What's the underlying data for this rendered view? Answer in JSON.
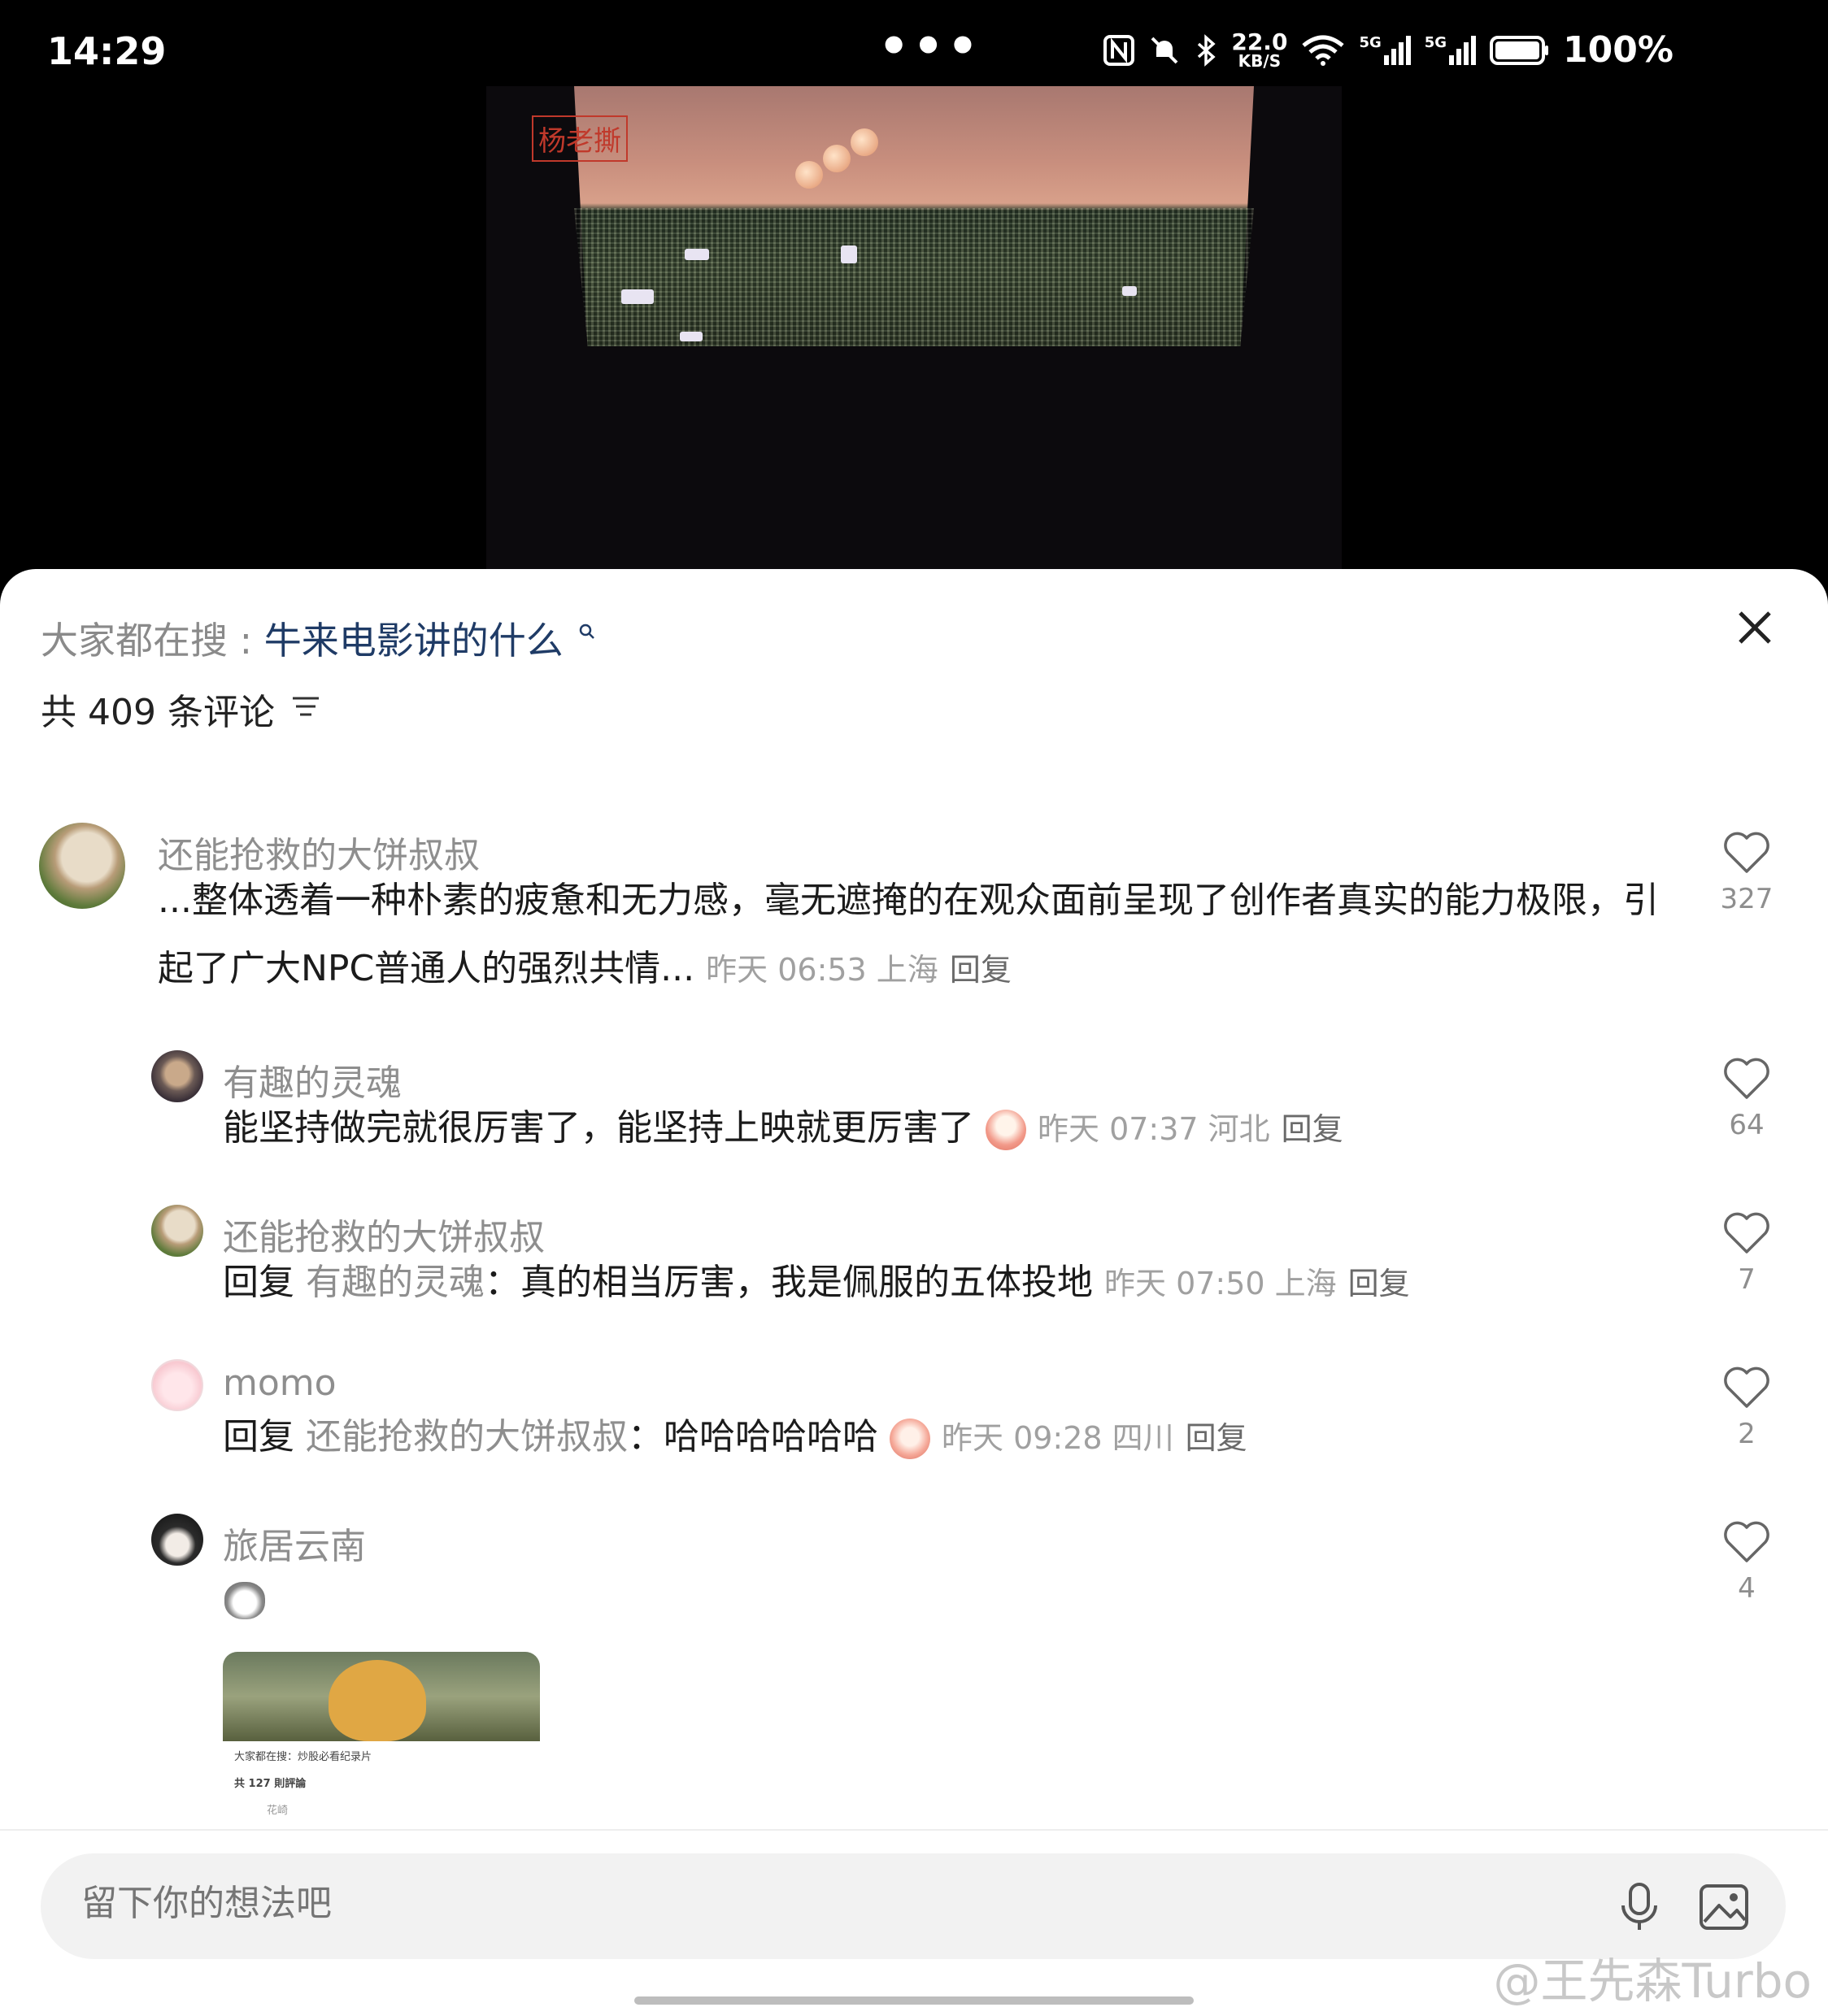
{
  "status": {
    "time": "14:29",
    "dots": "•••",
    "speed_value": "22.0",
    "speed_unit": "KB/S",
    "battery": "100%",
    "net1": "5G",
    "net2": "5G"
  },
  "video": {
    "seal_text": "杨老撕"
  },
  "header": {
    "search_prefix": "大家都在搜",
    "search_separator": ":",
    "search_term": "牛来电影讲的什么",
    "search_icon": "search-icon",
    "comment_count_text": "共 409 条评论",
    "close_icon": "close-icon",
    "sort_icon": "sort-icon"
  },
  "comments": [
    {
      "user": "还能抢救的大饼叔叔",
      "text_line1": "...整体透着一种朴素的疲惫和无力感，毫无遮掩的在观众面前呈现了创作者真实的能力极限，引",
      "text_line2": "起了广大NPC普通人的强烈共情...",
      "meta": "昨天 06:53 上海",
      "reply": "回复",
      "likes": "327"
    },
    {
      "user": "有趣的灵魂",
      "text": "能坚持做完就很厉害了，能坚持上映就更厉害了",
      "meta": "昨天 07:37 河北",
      "reply": "回复",
      "likes": "64"
    },
    {
      "user": "还能抢救的大饼叔叔",
      "reply_prefix": "回复",
      "reply_to": "有趣的灵魂",
      "text": "：真的相当厉害，我是佩服的五体投地",
      "meta": "昨天 07:50 上海",
      "reply": "回复",
      "likes": "7"
    },
    {
      "user": "momo",
      "reply_prefix": "回复",
      "reply_to": "还能抢救的大饼叔叔",
      "text": "：哈哈哈哈哈哈",
      "meta": "昨天 09:28 四川",
      "reply": "回复",
      "likes": "2"
    },
    {
      "user": "旅居云南",
      "likes": "4",
      "thumb": {
        "search_line": "大家都在搜：炒股必看纪录片",
        "count_line": "共 127 則評論",
        "user_line": "花崎"
      }
    }
  ],
  "input": {
    "placeholder": "留下你的想法吧",
    "mic_icon": "microphone-icon",
    "image_icon": "image-icon"
  },
  "watermark": "@王先森Turbo"
}
